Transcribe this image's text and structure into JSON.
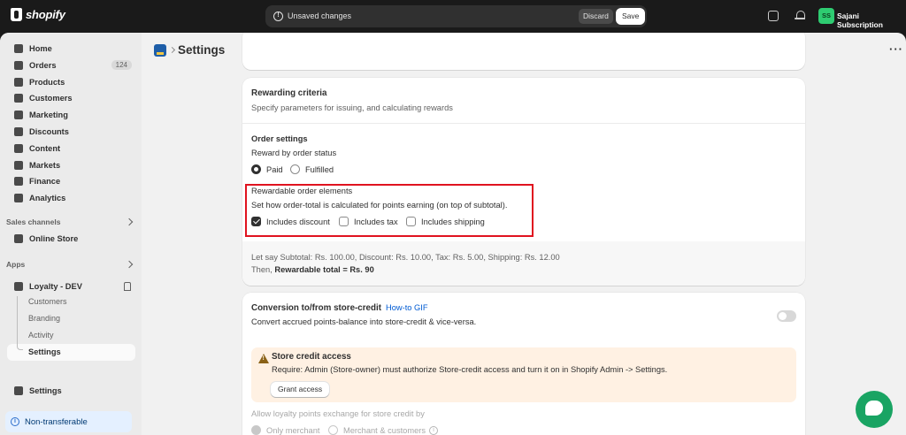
{
  "topbar": {
    "brand": "shopify",
    "unsaved_label": "Unsaved changes",
    "discard_label": "Discard",
    "save_label": "Save",
    "avatar_initials": "SS",
    "store_name": "Sajani Subscription"
  },
  "sidebar": {
    "items": [
      {
        "label": "Home",
        "icon": "home-icon"
      },
      {
        "label": "Orders",
        "icon": "orders-icon",
        "badge": "124"
      },
      {
        "label": "Products",
        "icon": "tag-icon"
      },
      {
        "label": "Customers",
        "icon": "person-icon"
      },
      {
        "label": "Marketing",
        "icon": "target-icon"
      },
      {
        "label": "Discounts",
        "icon": "discount-icon"
      },
      {
        "label": "Content",
        "icon": "content-icon"
      },
      {
        "label": "Markets",
        "icon": "globe-icon"
      },
      {
        "label": "Finance",
        "icon": "bank-icon"
      },
      {
        "label": "Analytics",
        "icon": "chart-icon"
      }
    ],
    "sales_channels_label": "Sales channels",
    "online_store_label": "Online Store",
    "apps_label": "Apps",
    "app_name": "Loyalty - DEV",
    "app_subitems": [
      "Customers",
      "Branding",
      "Activity",
      "Settings"
    ],
    "settings_label": "Settings",
    "non_transferable_label": "Non-transferable"
  },
  "header": {
    "title": "Settings"
  },
  "rewarding": {
    "title": "Rewarding criteria",
    "subtitle": "Specify parameters for issuing, and calculating rewards",
    "order_settings_title": "Order settings",
    "reward_by_status_label": "Reward by order status",
    "status_options": [
      {
        "label": "Paid",
        "selected": true
      },
      {
        "label": "Fulfilled",
        "selected": false
      }
    ],
    "elements_title": "Rewardable order elements",
    "elements_desc": "Set how order-total is calculated for points earning (on top of subtotal).",
    "elements": [
      {
        "label": "Includes discount",
        "checked": true
      },
      {
        "label": "Includes tax",
        "checked": false
      },
      {
        "label": "Includes shipping",
        "checked": false
      }
    ],
    "example_line": "Let say Subtotal: Rs. 100.00, Discount: Rs. 10.00, Tax: Rs. 5.00, Shipping: Rs. 12.00",
    "then_prefix": "Then, ",
    "then_bold": "Rewardable total = Rs. 90"
  },
  "conversion": {
    "title": "Conversion to/from store-credit",
    "howto_link": "How-to GIF",
    "description": "Convert accrued points-balance into store-credit & vice-versa.",
    "toggle_on": false,
    "banner_title": "Store credit access",
    "banner_text": "Require: Admin (Store-owner) must authorize Store-credit access and turn it on in Shopify Admin -> Settings.",
    "grant_label": "Grant access",
    "exchange_label": "Allow loyalty points exchange for store credit by",
    "exchange_options": [
      {
        "label": "Only merchant",
        "selected": true
      },
      {
        "label": "Merchant & customers",
        "selected": false
      }
    ]
  },
  "colors": {
    "accent": "#303030",
    "link": "#005bd3",
    "highlight": "#e0131f",
    "banner": "#fff1e3",
    "chat": "#19a463"
  }
}
